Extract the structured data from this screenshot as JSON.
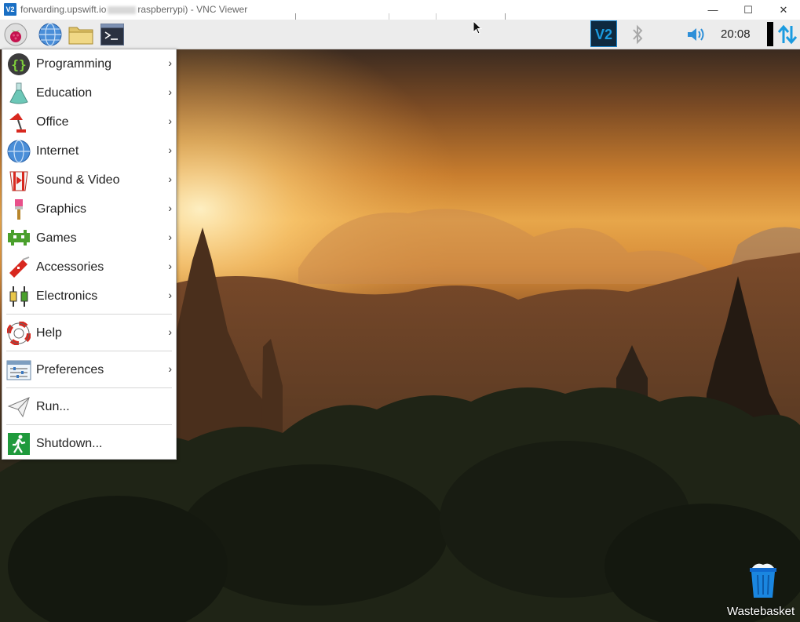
{
  "window": {
    "logo_text": "V2",
    "title_prefix": "forwarding.upswift.io",
    "title_suffix": "raspberrypi) - VNC Viewer",
    "minimize_glyph": "—",
    "maximize_glyph": "☐",
    "close_glyph": "✕"
  },
  "panel": {
    "launchers": [
      {
        "name": "raspberry-menu-icon"
      },
      {
        "name": "web-browser-icon"
      },
      {
        "name": "file-manager-icon"
      },
      {
        "name": "terminal-icon"
      }
    ],
    "tray": {
      "vnc_text": "V2",
      "clock": "20:08"
    }
  },
  "menu": {
    "items": [
      {
        "label": "Programming",
        "icon": "programming-icon",
        "submenu": true
      },
      {
        "label": "Education",
        "icon": "education-icon",
        "submenu": true
      },
      {
        "label": "Office",
        "icon": "office-icon",
        "submenu": true
      },
      {
        "label": "Internet",
        "icon": "internet-icon",
        "submenu": true
      },
      {
        "label": "Sound & Video",
        "icon": "sound-video-icon",
        "submenu": true
      },
      {
        "label": "Graphics",
        "icon": "graphics-icon",
        "submenu": true
      },
      {
        "label": "Games",
        "icon": "games-icon",
        "submenu": true
      },
      {
        "label": "Accessories",
        "icon": "accessories-icon",
        "submenu": true
      },
      {
        "label": "Electronics",
        "icon": "electronics-icon",
        "submenu": true
      },
      {
        "label": "Help",
        "icon": "help-icon",
        "submenu": true
      },
      {
        "label": "Preferences",
        "icon": "preferences-icon",
        "submenu": true
      },
      {
        "label": "Run...",
        "icon": "run-icon",
        "submenu": false
      },
      {
        "label": "Shutdown...",
        "icon": "shutdown-icon",
        "submenu": false
      }
    ],
    "arrow_glyph": "›"
  },
  "desktop": {
    "wastebasket_label": "Wastebasket"
  },
  "colors": {
    "vnc_blue": "#1a6fc4",
    "tray_arrows": "#1b9be0",
    "volume_blue": "#2e8fd8"
  }
}
